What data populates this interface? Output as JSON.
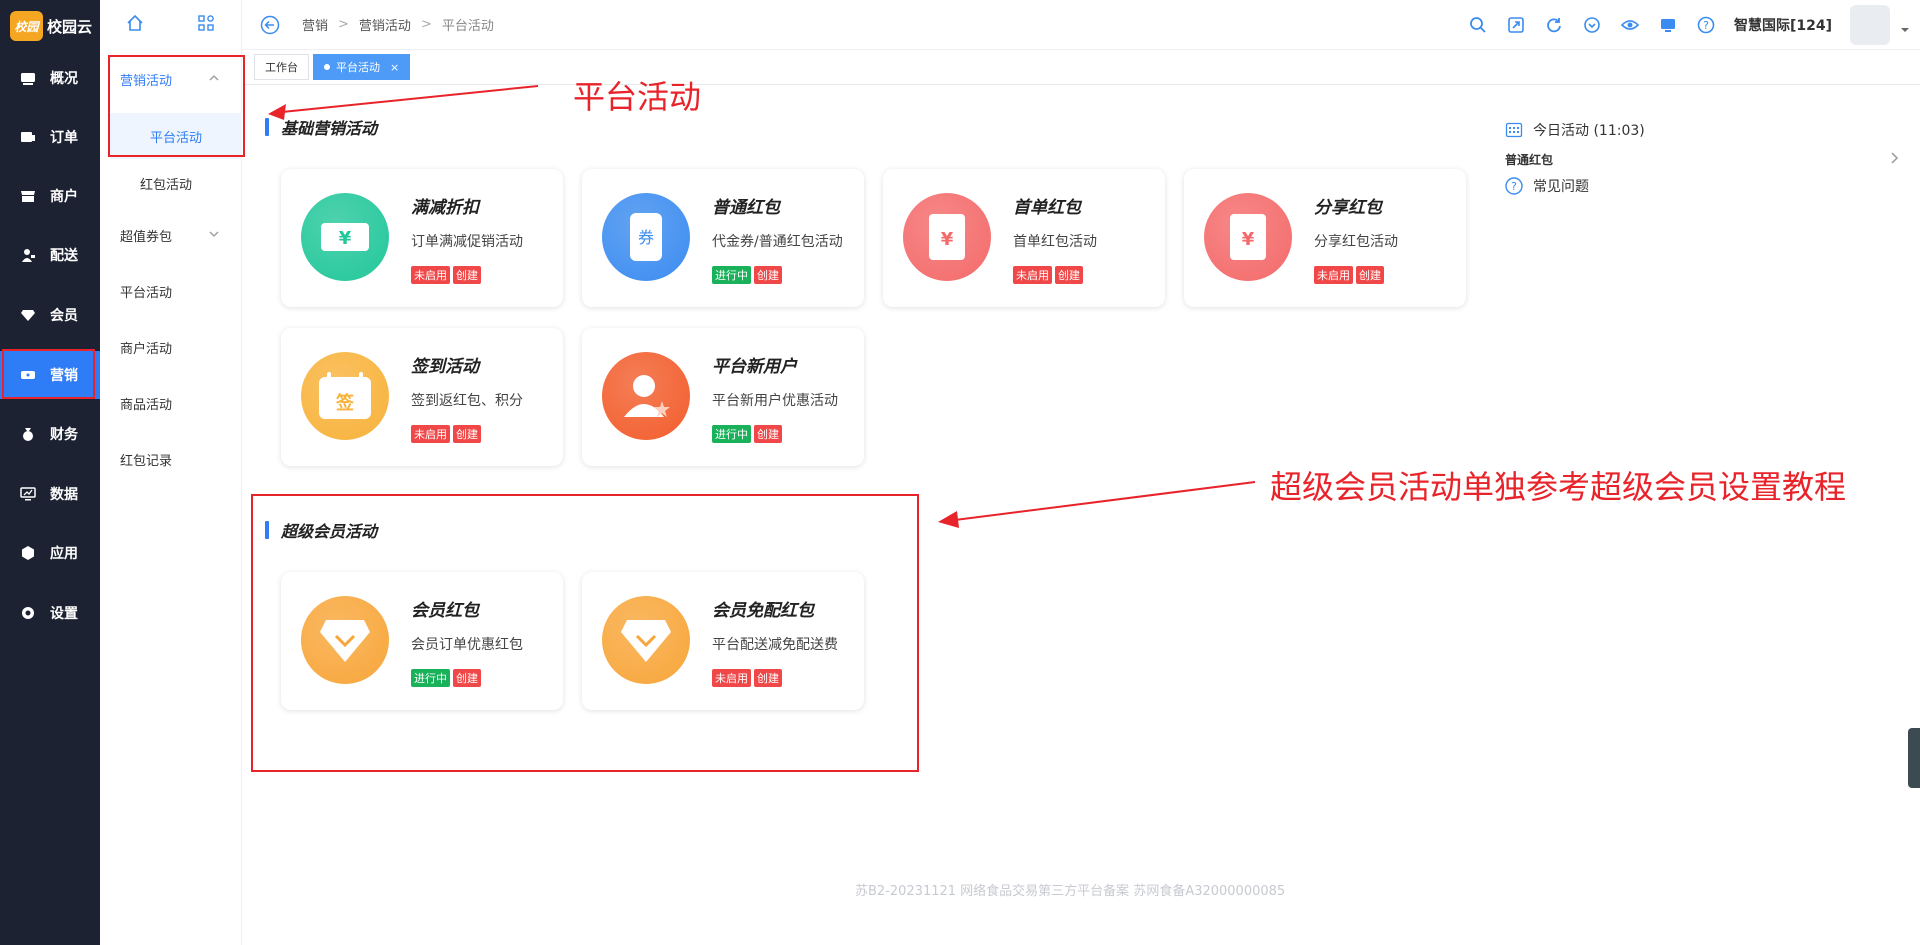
{
  "brand": {
    "logo_text": "校园",
    "name": "校园云"
  },
  "nav": {
    "items": [
      {
        "label": "概况",
        "icon": "dashboard-icon"
      },
      {
        "label": "订单",
        "icon": "order-icon"
      },
      {
        "label": "商户",
        "icon": "store-icon"
      },
      {
        "label": "配送",
        "icon": "delivery-icon"
      },
      {
        "label": "会员",
        "icon": "diamond-icon"
      },
      {
        "label": "营销",
        "icon": "ticket-icon",
        "active": true
      },
      {
        "label": "财务",
        "icon": "money-bag-icon"
      },
      {
        "label": "数据",
        "icon": "monitor-icon"
      },
      {
        "label": "应用",
        "icon": "cube-icon"
      },
      {
        "label": "设置",
        "icon": "gear-icon"
      }
    ]
  },
  "subnav": {
    "items": [
      {
        "label": "营销活动",
        "type": "group-open"
      },
      {
        "label": "平台活动",
        "type": "child-selected"
      },
      {
        "label": "红包活动",
        "type": "child"
      },
      {
        "label": "超值券包",
        "type": "group"
      },
      {
        "label": "平台活动",
        "type": "item"
      },
      {
        "label": "商户活动",
        "type": "item"
      },
      {
        "label": "商品活动",
        "type": "item"
      },
      {
        "label": "红包记录",
        "type": "item"
      }
    ]
  },
  "breadcrumb": [
    "营销",
    "营销活动",
    "平台活动"
  ],
  "topbar": {
    "store_name": "智慧国际[124]"
  },
  "tabs": [
    {
      "label": "工作台",
      "active": false
    },
    {
      "label": "平台活动",
      "active": true,
      "close": "×"
    }
  ],
  "sections": {
    "basic": {
      "title": "基础营销活动",
      "cards": [
        {
          "title": "满减折扣",
          "desc": "订单满减促销活动",
          "status": "未启用",
          "status_color": "red",
          "action": "创建",
          "icon": "ticket-yen-icon",
          "color": "#22c79a"
        },
        {
          "title": "普通红包",
          "desc": "代金券/普通红包活动",
          "status": "进行中",
          "status_color": "green",
          "action": "创建",
          "icon": "coupon-icon",
          "color": "#3b8cf0"
        },
        {
          "title": "首单红包",
          "desc": "首单红包活动",
          "status": "未启用",
          "status_color": "red",
          "action": "创建",
          "icon": "red-envelope-icon",
          "color": "#f46a6a"
        },
        {
          "title": "分享红包",
          "desc": "分享红包活动",
          "status": "未启用",
          "status_color": "red",
          "action": "创建",
          "icon": "red-envelope-icon",
          "color": "#f46a6a"
        },
        {
          "title": "签到活动",
          "desc": "签到返红包、积分",
          "status": "未启用",
          "status_color": "red",
          "action": "创建",
          "icon": "calendar-sign-icon",
          "color": "#f8b23a"
        },
        {
          "title": "平台新用户",
          "desc": "平台新用户优惠活动",
          "status": "进行中",
          "status_color": "green",
          "action": "创建",
          "icon": "new-user-icon",
          "color": "#f25d2c"
        }
      ]
    },
    "super": {
      "title": "超级会员活动",
      "cards": [
        {
          "title": "会员红包",
          "desc": "会员订单优惠红包",
          "status": "进行中",
          "status_color": "green",
          "action": "创建",
          "icon": "member-diamond-icon",
          "color": "#f8a63a"
        },
        {
          "title": "会员免配红包",
          "desc": "平台配送减免配送费",
          "status": "未启用",
          "status_color": "red",
          "action": "创建",
          "icon": "member-diamond-icon",
          "color": "#f8a63a"
        }
      ]
    }
  },
  "right_panel": {
    "today": "今日活动 (11:03)",
    "sub_label": "普通红包",
    "faq": "常见问题"
  },
  "annotations": {
    "platform": "平台活动",
    "super_note": "超级会员活动单独参考超级会员设置教程"
  },
  "footer": "苏B2-20231121  网络食品交易第三方平台备案 苏网食备A32000000085"
}
